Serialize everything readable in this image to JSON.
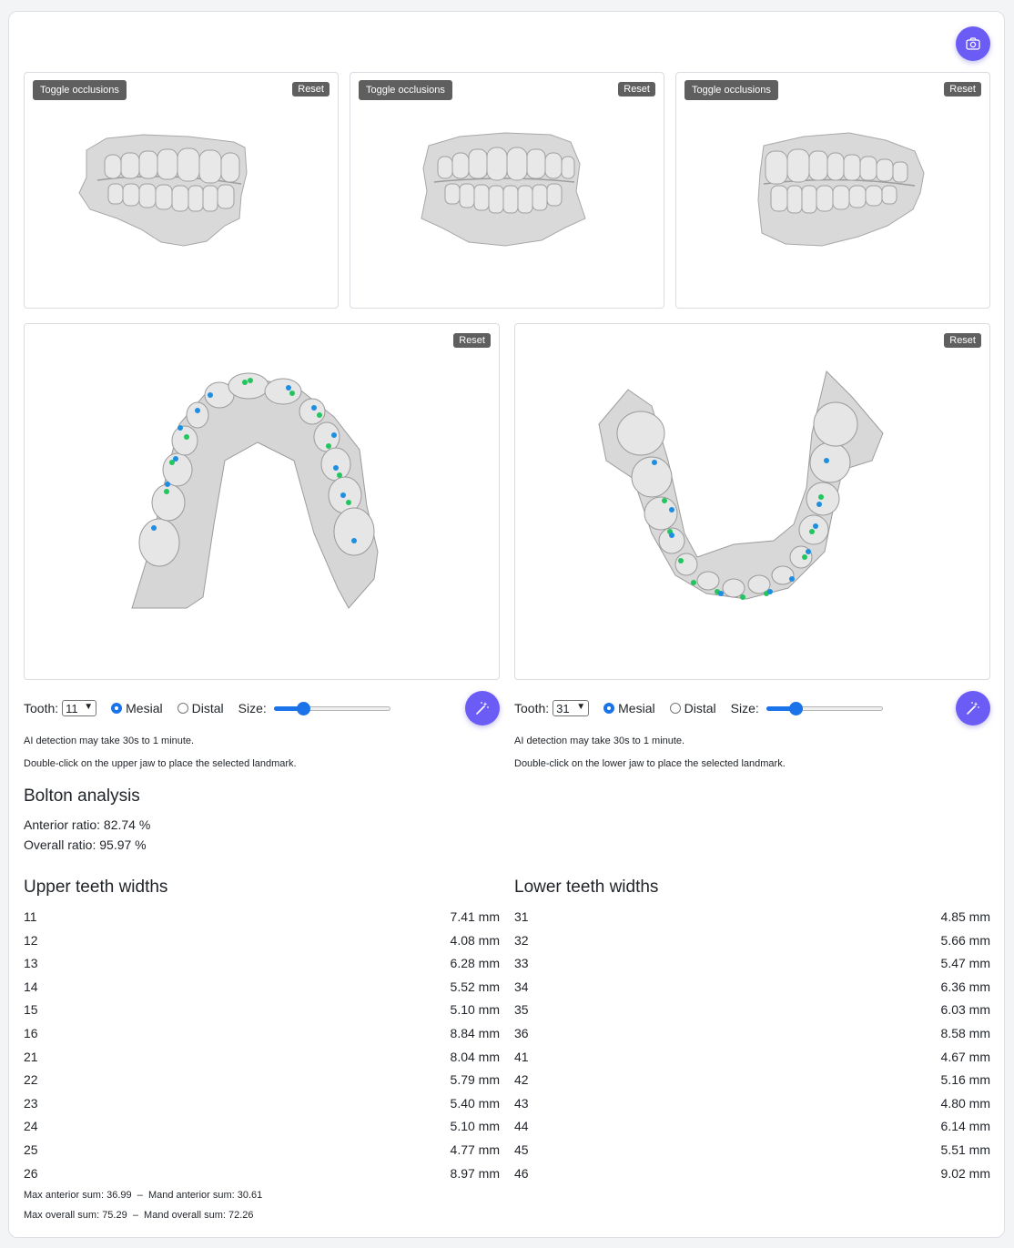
{
  "colors": {
    "accent": "#6b5cf5",
    "radio_blue": "#1a73e8",
    "chip_bg": "#5f5f5f",
    "landmark_blue": "#1f8ee0",
    "landmark_green": "#22c55e"
  },
  "toolbar": {
    "camera_icon": "camera-icon"
  },
  "occlusion_views": [
    {
      "toggle_label": "Toggle occlusions",
      "reset_label": "Reset"
    },
    {
      "toggle_label": "Toggle occlusions",
      "reset_label": "Reset"
    },
    {
      "toggle_label": "Toggle occlusions",
      "reset_label": "Reset"
    }
  ],
  "upper_jaw": {
    "reset_label": "Reset",
    "tooth_label": "Tooth:",
    "tooth_value": "11",
    "mesial_label": "Mesial",
    "distal_label": "Distal",
    "selected_side": "Mesial",
    "size_label": "Size:",
    "size_level": 0.25,
    "note_ai": "AI detection may take 30s to 1 minute.",
    "note_place": "Double-click on the upper jaw to place the selected landmark."
  },
  "lower_jaw": {
    "reset_label": "Reset",
    "tooth_label": "Tooth:",
    "tooth_value": "31",
    "mesial_label": "Mesial",
    "distal_label": "Distal",
    "selected_side": "Mesial",
    "size_label": "Size:",
    "size_level": 0.25,
    "note_ai": "AI detection may take 30s to 1 minute.",
    "note_place": "Double-click on the lower jaw to place the selected landmark."
  },
  "bolton": {
    "title": "Bolton analysis",
    "anterior": "Anterior ratio: 82.74 %",
    "overall": "Overall ratio: 95.97 %"
  },
  "upper_widths": {
    "title": "Upper teeth widths",
    "rows": [
      {
        "tooth": "11",
        "width": "7.41 mm"
      },
      {
        "tooth": "12",
        "width": "4.08 mm"
      },
      {
        "tooth": "13",
        "width": "6.28 mm"
      },
      {
        "tooth": "14",
        "width": "5.52 mm"
      },
      {
        "tooth": "15",
        "width": "5.10 mm"
      },
      {
        "tooth": "16",
        "width": "8.84 mm"
      },
      {
        "tooth": "21",
        "width": "8.04 mm"
      },
      {
        "tooth": "22",
        "width": "5.79 mm"
      },
      {
        "tooth": "23",
        "width": "5.40 mm"
      },
      {
        "tooth": "24",
        "width": "5.10 mm"
      },
      {
        "tooth": "25",
        "width": "4.77 mm"
      },
      {
        "tooth": "26",
        "width": "8.97 mm"
      }
    ]
  },
  "lower_widths": {
    "title": "Lower teeth widths",
    "rows": [
      {
        "tooth": "31",
        "width": "4.85 mm"
      },
      {
        "tooth": "32",
        "width": "5.66 mm"
      },
      {
        "tooth": "33",
        "width": "5.47 mm"
      },
      {
        "tooth": "34",
        "width": "6.36 mm"
      },
      {
        "tooth": "35",
        "width": "6.03 mm"
      },
      {
        "tooth": "36",
        "width": "8.58 mm"
      },
      {
        "tooth": "41",
        "width": "4.67 mm"
      },
      {
        "tooth": "42",
        "width": "5.16 mm"
      },
      {
        "tooth": "43",
        "width": "4.80 mm"
      },
      {
        "tooth": "44",
        "width": "6.14 mm"
      },
      {
        "tooth": "45",
        "width": "5.51 mm"
      },
      {
        "tooth": "46",
        "width": "9.02 mm"
      }
    ]
  },
  "sums": {
    "anterior": "Max anterior sum: 36.99  –  Mand anterior sum: 30.61",
    "overall": "Max overall sum: 75.29  –  Mand overall sum: 72.26"
  }
}
